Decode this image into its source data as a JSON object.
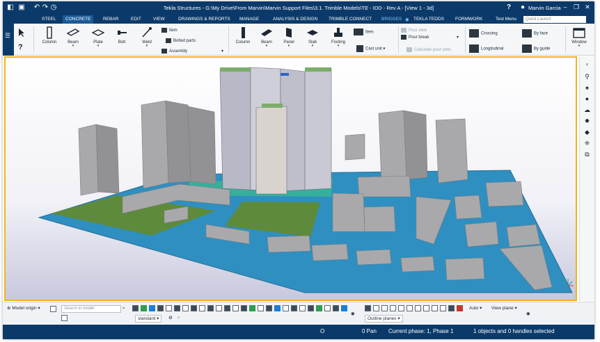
{
  "titlebar": {
    "title": "Tekla Structures - G:\\My Drive\\From Marvin\\Marvin Support Files\\3.1. Trimble Models\\TE - IDD - Rev A - [View 1 - 3d]",
    "user": "Marvin Garcia",
    "help_icon": "help-icon"
  },
  "tabs": [
    "STEEL",
    "CONCRETE",
    "REBAR",
    "EDIT",
    "VIEW",
    "DRAWINGS & REPORTS",
    "MANAGE",
    "ANALYSIS & DESIGN",
    "TRIMBLE CONNECT",
    "BRIDGES",
    "TEKLA TEDDS",
    "FORMWORK",
    "Test Menu"
  ],
  "active_tab": "CONCRETE",
  "search": {
    "placeholder": "Quick Launch"
  },
  "ribbon": {
    "steel": {
      "column": "Column",
      "beam": "Beam",
      "plate": "Plate",
      "bolt": "Bolt",
      "weld": "Weld"
    },
    "small": {
      "item": "Item",
      "bolted_parts": "Bolted parts",
      "assembly": "Assembly"
    },
    "concrete": {
      "column": "Column",
      "beam": "Beam",
      "panel": "Panel",
      "slab": "Slab",
      "footing": "Footing",
      "item": "Item",
      "cast_unit": "Cast unit"
    },
    "pour": {
      "pour_view": "Pour view",
      "pour_break": "Pour break",
      "calculate": "Calculate pour units"
    },
    "rebar": {
      "crossing": "Crossing",
      "longitudinal": "Longitudinal",
      "by_face": "By face",
      "by_guide": "By guide"
    },
    "window": "Window"
  },
  "bottom": {
    "model_origin": "Model origin",
    "search_placeholder": "Search in model",
    "standard": "standard",
    "auto": "Auto",
    "view_plane": "View plane",
    "outline_planes": "Outline planes"
  },
  "status": {
    "o": "O",
    "pan": "0  Pan",
    "phase": "Current phase: 1, Phase 1",
    "selection": "1 objects and 0 handles selected"
  },
  "colors": {
    "titlebar": "#0b3a6a",
    "viewport_border": "#f2b516",
    "ground_blue": "#2f8fc0",
    "grass": "#5e8a3c",
    "building": "#a9a9ab"
  }
}
